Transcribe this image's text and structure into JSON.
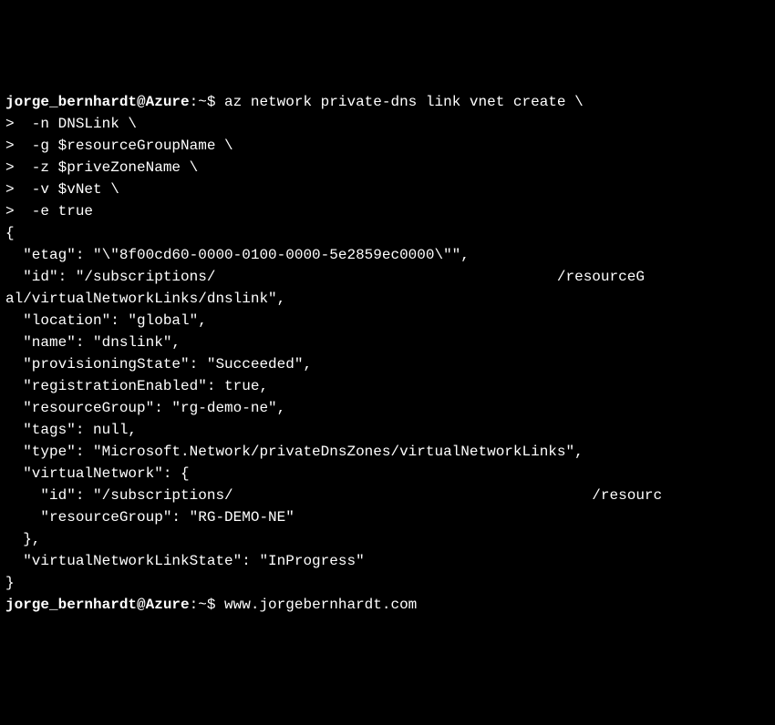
{
  "lines": [
    {
      "prefix": "jorge_bernhardt@Azure",
      "prefixBold": true,
      "sep": ":~$ ",
      "text": "az network private-dns link vnet create \\"
    },
    {
      "text": ">  -n DNSLink \\"
    },
    {
      "text": ">  -g $resourceGroupName \\"
    },
    {
      "text": ">  -z $priveZoneName \\"
    },
    {
      "text": ">  -v $vNet \\"
    },
    {
      "text": ">  -e true"
    },
    {
      "text": "{"
    },
    {
      "text": "  \"etag\": \"\\\"8f00cd60-0000-0100-0000-5e2859ec0000\\\"\","
    },
    {
      "text": "  \"id\": \"/subscriptions/                                       /resourceG"
    },
    {
      "text": "al/virtualNetworkLinks/dnslink\","
    },
    {
      "text": "  \"location\": \"global\","
    },
    {
      "text": "  \"name\": \"dnslink\","
    },
    {
      "text": "  \"provisioningState\": \"Succeeded\","
    },
    {
      "text": "  \"registrationEnabled\": true,"
    },
    {
      "text": "  \"resourceGroup\": \"rg-demo-ne\","
    },
    {
      "text": "  \"tags\": null,"
    },
    {
      "text": "  \"type\": \"Microsoft.Network/privateDnsZones/virtualNetworkLinks\","
    },
    {
      "text": "  \"virtualNetwork\": {"
    },
    {
      "text": "    \"id\": \"/subscriptions/                                         /resourc"
    },
    {
      "text": "    \"resourceGroup\": \"RG-DEMO-NE\""
    },
    {
      "text": "  },"
    },
    {
      "text": "  \"virtualNetworkLinkState\": \"InProgress\""
    },
    {
      "text": "}"
    },
    {
      "prefix": "jorge_bernhardt@Azure",
      "prefixBold": true,
      "sep": ":~$ ",
      "text": "www.jorgebernhardt.com"
    }
  ]
}
